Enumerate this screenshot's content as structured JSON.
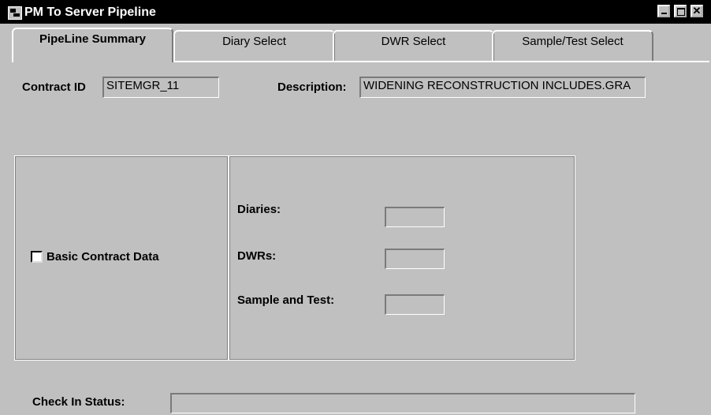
{
  "window": {
    "title": "PM To Server Pipeline"
  },
  "tabs": [
    {
      "label": "PipeLine Summary",
      "active": true
    },
    {
      "label": "Diary Select",
      "active": false
    },
    {
      "label": "DWR Select",
      "active": false
    },
    {
      "label": "Sample/Test Select",
      "active": false
    }
  ],
  "contract": {
    "id_label": "Contract ID",
    "id_value": "SITEMGR_11",
    "description_label": "Description:",
    "description_value": "WIDENING RECONSTRUCTION INCLUDES.GRA"
  },
  "options": {
    "basic_contract_label": "Basic Contract Data",
    "basic_contract_checked": false
  },
  "counts": {
    "diaries_label": "Diaries:",
    "diaries_value": "",
    "dwrs_label": "DWRs:",
    "dwrs_value": "",
    "sample_test_label": "Sample and Test:",
    "sample_test_value": ""
  },
  "status": {
    "label": "Check In Status:",
    "value": ""
  },
  "icons": {
    "app": "pipeline-app-icon",
    "minimize": "minimize-icon",
    "maximize": "maximize-icon",
    "close": "close-icon"
  }
}
